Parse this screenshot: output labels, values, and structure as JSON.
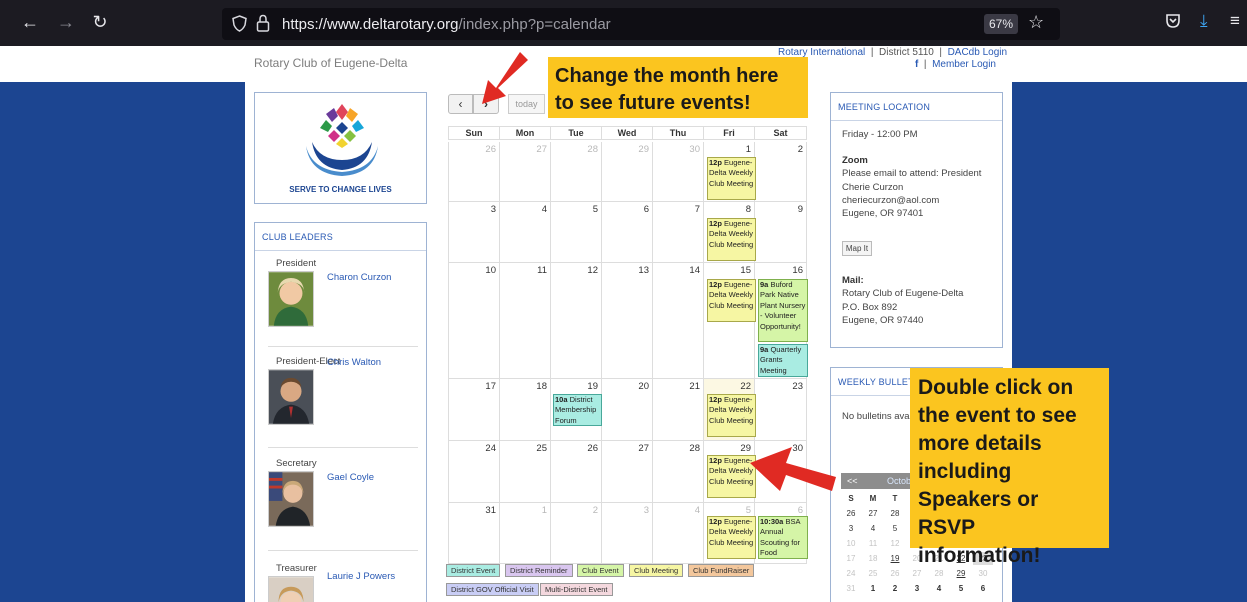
{
  "browser": {
    "url_domain": "https://www.deltarotary.org",
    "url_path": "/index.php?p=calendar",
    "zoom": "67%",
    "icons": {
      "back": "arrow-left-icon",
      "forward": "arrow-right-icon",
      "reload": "reload-icon",
      "menu": "hamburger-menu-icon"
    }
  },
  "header": {
    "club_title": "Rotary Club of Eugene-Delta",
    "links_line1": [
      "Rotary International",
      "District 5110",
      "DACdb Login"
    ],
    "links_line2_icon": "f",
    "links_line2": "Member Login"
  },
  "logo": {
    "text": "SERVE TO CHANGE LIVES"
  },
  "leaders": {
    "title": "CLUB LEADERS",
    "items": [
      {
        "role": "President",
        "name": "Charon Curzon"
      },
      {
        "role": "President-Elect",
        "name": "Chris Walton"
      },
      {
        "role": "Secretary",
        "name": "Gael Coyle"
      },
      {
        "role": "Treasurer",
        "name": "Laurie J Powers"
      }
    ]
  },
  "calendar": {
    "prev_label": "‹",
    "next_label": "›",
    "today_label": "today",
    "days": [
      "Sun",
      "Mon",
      "Tue",
      "Wed",
      "Thu",
      "Fri",
      "Sat"
    ],
    "weeks": [
      [
        "26",
        "27",
        "28",
        "29",
        "30",
        "1",
        "2"
      ],
      [
        "3",
        "4",
        "5",
        "6",
        "7",
        "8",
        "9"
      ],
      [
        "10",
        "11",
        "12",
        "13",
        "14",
        "15",
        "16"
      ],
      [
        "17",
        "18",
        "19",
        "20",
        "21",
        "22",
        "23"
      ],
      [
        "24",
        "25",
        "26",
        "27",
        "28",
        "29",
        "30"
      ],
      [
        "31",
        "1",
        "2",
        "3",
        "4",
        "5",
        "6"
      ]
    ],
    "events": {
      "weekly_time": "12p",
      "weekly_title": "Eugene-Delta Weekly Club Meeting",
      "buford_time": "9a",
      "buford_title": "Buford Park Native Plant Nursery - Volunteer Opportunity!",
      "grants_time": "9a",
      "grants_title": "Quarterly Grants Meeting",
      "forum_time": "10a",
      "forum_title": "District Membership Forum",
      "bsa_time": "10:30a",
      "bsa_title": "BSA Annual Scouting for Food"
    },
    "legend": [
      {
        "label": "District Event",
        "color": "#a9ece2"
      },
      {
        "label": "District Reminder",
        "color": "#d9c6ef"
      },
      {
        "label": "Club Event",
        "color": "#d5f5a7"
      },
      {
        "label": "Club Meeting",
        "color": "#f6f6a3"
      },
      {
        "label": "Club FundRaiser",
        "color": "#f3c79c"
      },
      {
        "label": "District GOV Official Visit",
        "color": "#c9cdf5"
      },
      {
        "label": "Multi-District Event",
        "color": "#f4d8de"
      }
    ]
  },
  "meeting": {
    "title": "MEETING LOCATION",
    "when": "Friday - 12:00 PM",
    "zoom_label": "Zoom",
    "zoom_lines": [
      "Please email to attend: President",
      "Cherie Curzon",
      "cheriecurzon@aol.com",
      "Eugene, OR 97401"
    ],
    "map_button": "Map It",
    "mail_label": "Mail:",
    "mail_lines": [
      "Rotary Club of Eugene-Delta",
      "P.O. Box 892",
      "Eugene, OR 97440"
    ]
  },
  "bulletins": {
    "title": "WEEKLY BULLETIN",
    "empty": "No bulletins avai"
  },
  "mini_calendar": {
    "prev": "<<",
    "title": "Octob",
    "dow": [
      "S",
      "M",
      "T"
    ],
    "rows": [
      [
        "26",
        "27",
        "28",
        "",
        "",
        "",
        ""
      ],
      [
        "3",
        "4",
        "5",
        "",
        "",
        "",
        ""
      ],
      [
        "10",
        "11",
        "12",
        "",
        "",
        "",
        ""
      ],
      [
        "17",
        "18",
        "19",
        "20",
        "21",
        "22",
        "23"
      ],
      [
        "24",
        "25",
        "26",
        "27",
        "28",
        "29",
        "30"
      ],
      [
        "31",
        "1",
        "2",
        "3",
        "4",
        "5",
        "6"
      ]
    ]
  },
  "callouts": {
    "month": "Change the month here to see future events!",
    "event": "Double click on the event to see more details including Speakers or RSVP information!"
  }
}
